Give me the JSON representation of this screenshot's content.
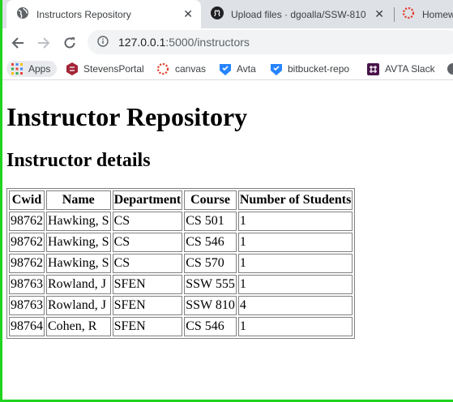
{
  "tabs": [
    {
      "title": "Instructors Repository",
      "icon": "globe-icon",
      "active": true
    },
    {
      "title": "Upload files · dgoalla/SSW-810",
      "icon": "github-icon",
      "active": false
    },
    {
      "title": "Homew",
      "icon": "canvas-icon",
      "active": false
    }
  ],
  "toolbar": {
    "url_host": "127.0.0.1",
    "url_path": ":5000/instructors"
  },
  "bookmarks": [
    {
      "label": "Apps",
      "icon": "apps-grid-icon"
    },
    {
      "label": "StevensPortal",
      "icon": "stevens-icon"
    },
    {
      "label": "canvas",
      "icon": "canvas-icon"
    },
    {
      "label": "Avta",
      "icon": "bookmark-shield-icon"
    },
    {
      "label": "bitbucket-repo",
      "icon": "bitbucket-icon"
    },
    {
      "label": "AVTA Slack",
      "icon": "slack-icon"
    }
  ],
  "page": {
    "heading": "Instructor Repository",
    "subheading": "Instructor details",
    "table": {
      "headers": [
        "Cwid",
        "Name",
        "Department",
        "Course",
        "Number of Students"
      ],
      "rows": [
        [
          "98762",
          "Hawking, S",
          "CS",
          "CS 501",
          "1"
        ],
        [
          "98762",
          "Hawking, S",
          "CS",
          "CS 546",
          "1"
        ],
        [
          "98762",
          "Hawking, S",
          "CS",
          "CS 570",
          "1"
        ],
        [
          "98763",
          "Rowland, J",
          "SFEN",
          "SSW 555",
          "1"
        ],
        [
          "98763",
          "Rowland, J",
          "SFEN",
          "SSW 810",
          "4"
        ],
        [
          "98764",
          "Cohen, R",
          "SFEN",
          "CS 546",
          "1"
        ]
      ]
    }
  },
  "colors": {
    "tabstrip": "#dee1e6",
    "omnibox": "#f1f3f4",
    "frame_accent": "#1fd31f"
  }
}
